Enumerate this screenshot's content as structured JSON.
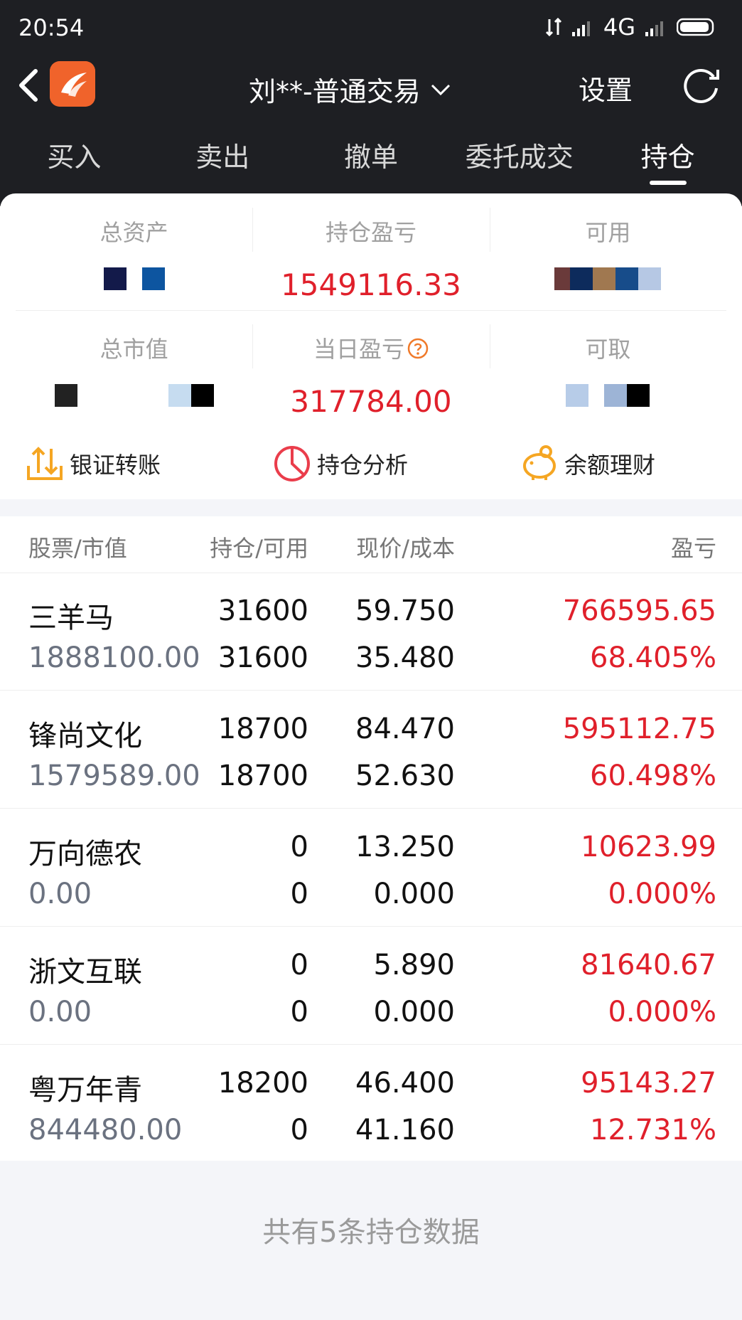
{
  "status_bar": {
    "time": "20:54",
    "network": "4G"
  },
  "nav": {
    "account_title": "刘**-普通交易",
    "settings_label": "设置"
  },
  "tabs": [
    {
      "label": "买入",
      "active": false
    },
    {
      "label": "卖出",
      "active": false
    },
    {
      "label": "撤单",
      "active": false
    },
    {
      "label": "委托成交",
      "active": false
    },
    {
      "label": "持仓",
      "active": true
    }
  ],
  "summary": {
    "total_assets_label": "总资产",
    "position_pnl_label": "持仓盈亏",
    "position_pnl_value": "1549116.33",
    "available_label": "可用",
    "total_market_value_label": "总市值",
    "daily_pnl_label": "当日盈亏",
    "daily_pnl_value": "317784.00",
    "withdrawable_label": "可取"
  },
  "actions": {
    "bank_transfer": "银证转账",
    "position_analysis": "持仓分析",
    "balance_finance": "余额理财"
  },
  "table": {
    "headers": {
      "stock": "股票/市值",
      "position": "持仓/可用",
      "price": "现价/成本",
      "pnl": "盈亏"
    },
    "rows": [
      {
        "name": "三羊马",
        "market_value": "1888100.00",
        "quantity": "31600",
        "available": "31600",
        "price": "59.750",
        "cost": "35.480",
        "pnl": "766595.65",
        "pnl_pct": "68.405%"
      },
      {
        "name": "锋尚文化",
        "market_value": "1579589.00",
        "quantity": "18700",
        "available": "18700",
        "price": "84.470",
        "cost": "52.630",
        "pnl": "595112.75",
        "pnl_pct": "60.498%"
      },
      {
        "name": "万向德农",
        "market_value": "0.00",
        "quantity": "0",
        "available": "0",
        "price": "13.250",
        "cost": "0.000",
        "pnl": "10623.99",
        "pnl_pct": "0.000%"
      },
      {
        "name": "浙文互联",
        "market_value": "0.00",
        "quantity": "0",
        "available": "0",
        "price": "5.890",
        "cost": "0.000",
        "pnl": "81640.67",
        "pnl_pct": "0.000%"
      },
      {
        "name": "粤万年青",
        "market_value": "844480.00",
        "quantity": "18200",
        "available": "0",
        "price": "46.400",
        "cost": "41.160",
        "pnl": "95143.27",
        "pnl_pct": "12.731%"
      }
    ]
  },
  "footer_note": "共有5条持仓数据",
  "colors": {
    "header_bg": "#1e1f23",
    "profit_red": "#e0202b",
    "brand_orange": "#f0632b",
    "action_orange": "#f5a623"
  },
  "icons": {
    "back": "chevron-left-icon",
    "logo": "app-logo",
    "dropdown": "chevron-down-icon",
    "refresh": "refresh-icon",
    "help": "question-circle-icon",
    "bank_transfer": "transfer-arrows-icon",
    "position_analysis": "pie-chart-icon",
    "balance_finance": "piggy-bank-icon"
  }
}
